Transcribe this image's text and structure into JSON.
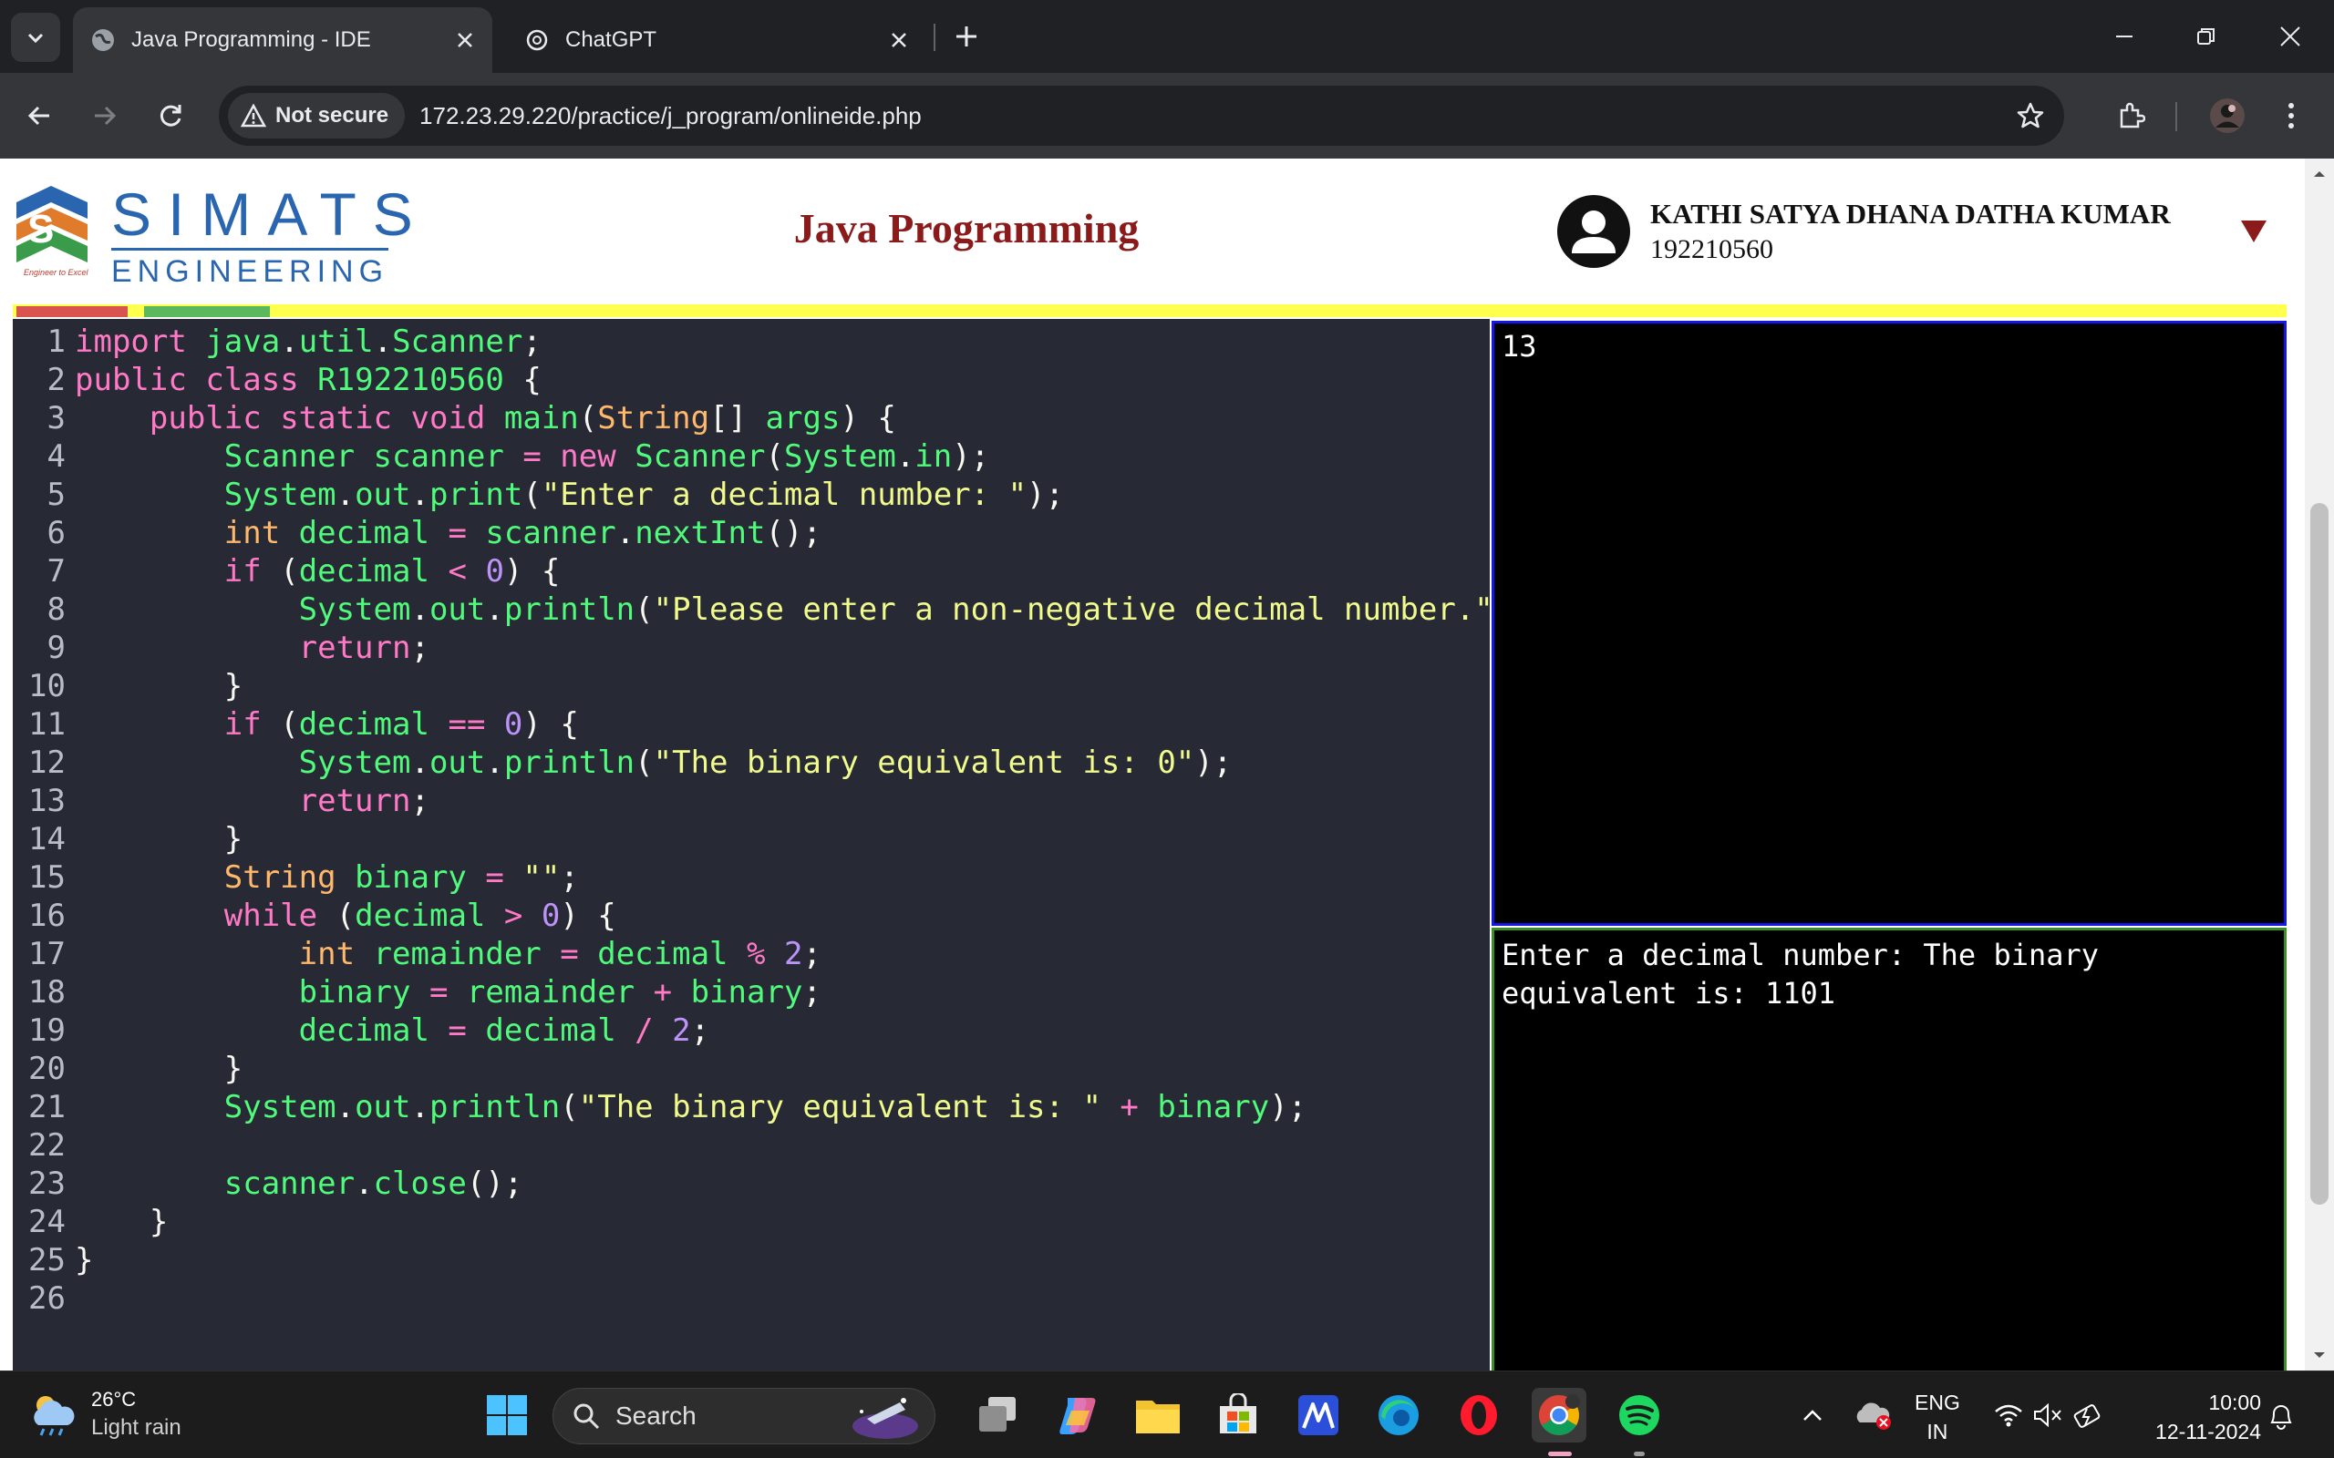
{
  "browser": {
    "tabs": [
      {
        "title": "Java Programming - IDE",
        "active": true
      },
      {
        "title": "ChatGPT",
        "active": false
      }
    ],
    "security_label": "Not secure",
    "url": "172.23.29.220/practice/j_program/onlineide.php"
  },
  "header": {
    "logo": {
      "name": "SIMATS",
      "subname": "ENGINEERING",
      "tagline": "Engineer to Excel"
    },
    "title": "Java Programming",
    "user_name": "KATHI SATYA DHANA DATHA KUMAR",
    "user_id": "192210560"
  },
  "progress_colors": {
    "strip": "#ffff4d",
    "segment_1": "#d9534f",
    "segment_2": "#5cb85c"
  },
  "editor": {
    "line_numbers": [
      "1",
      "2",
      "3",
      "4",
      "5",
      "6",
      "7",
      "8",
      "9",
      "10",
      "11",
      "12",
      "13",
      "14",
      "15",
      "16",
      "17",
      "18",
      "19",
      "20",
      "21",
      "22",
      "23",
      "24",
      "25",
      "26"
    ],
    "lines": [
      "import java.util.Scanner;",
      "public class R192210560 {",
      "    public static void main(String[] args) {",
      "        Scanner scanner = new Scanner(System.in);",
      "        System.out.print(\"Enter a decimal number: \");",
      "        int decimal = scanner.nextInt();",
      "        if (decimal < 0) {",
      "            System.out.println(\"Please enter a non-negative decimal number.\");",
      "            return;",
      "        }",
      "        if (decimal == 0) {",
      "            System.out.println(\"The binary equivalent is: 0\");",
      "            return;",
      "        }",
      "        String binary = \"\";",
      "        while (decimal > 0) {",
      "            int remainder = decimal % 2;",
      "            binary = remainder + binary;",
      "            decimal = decimal / 2;",
      "        }",
      "        System.out.println(\"The binary equivalent is: \" + binary);",
      "",
      "        scanner.close();",
      "    }",
      "}",
      ""
    ]
  },
  "console": {
    "input_value": "13",
    "output_text": "Enter a decimal number: The binary equivalent is: 1101"
  },
  "taskbar": {
    "weather_temp": "26°C",
    "weather_desc": "Light rain",
    "search_placeholder": "Search",
    "lang_line1": "ENG",
    "lang_line2": "IN",
    "time": "10:00",
    "date": "12-11-2024"
  }
}
